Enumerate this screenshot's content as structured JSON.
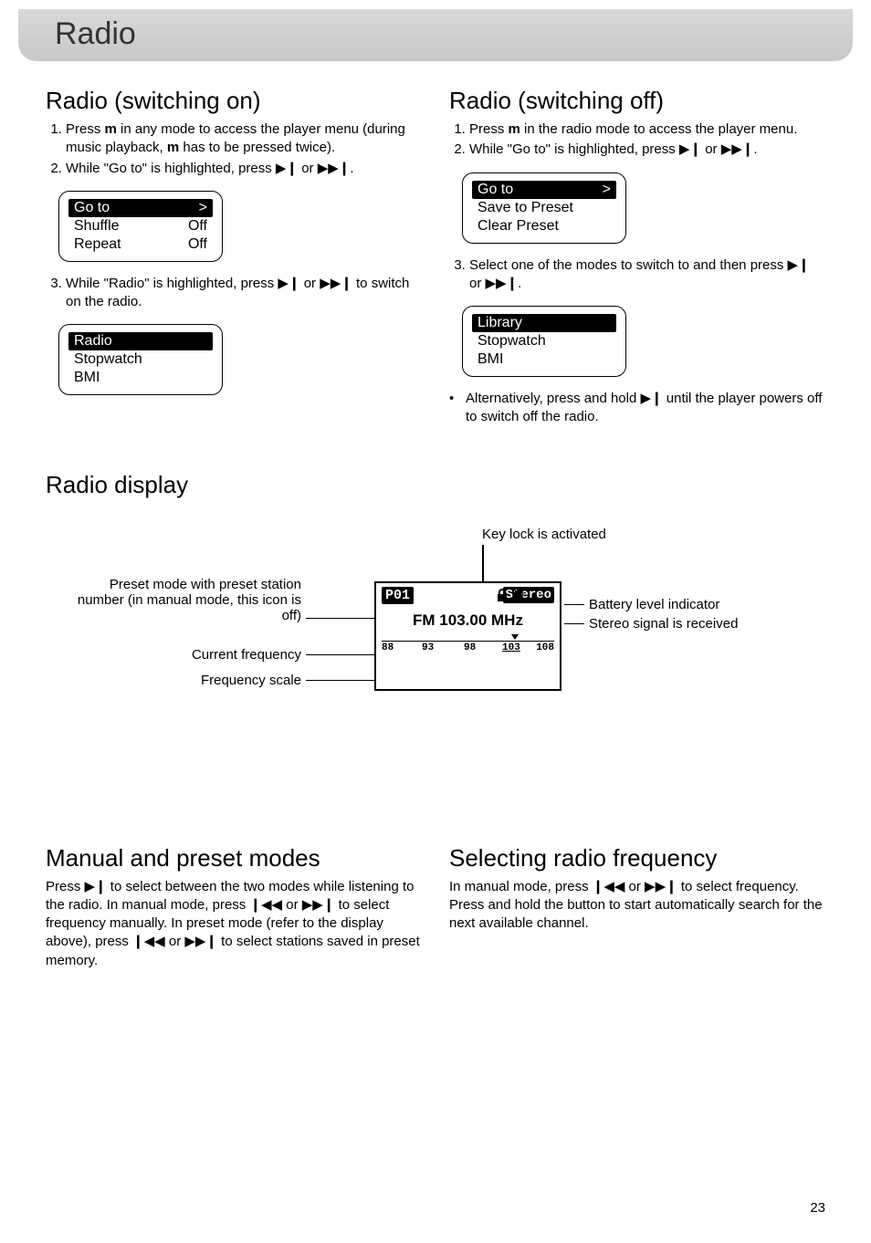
{
  "header": {
    "title": "Radio"
  },
  "left": {
    "switch_on_title": "Radio (switching on)",
    "steps_on": {
      "0_a": "Press ",
      "0_m": "m",
      "0_b": " in any mode to access the player menu (during music playback, ",
      "0_m2": "m",
      "0_c": " has to be pressed twice).",
      "1": "While \"Go to\" is highlighted, press ▶❙ or ▶▶❙.",
      "2": "While \"Radio\" is highlighted, press ▶❙ or ▶▶❙ to switch on the radio."
    },
    "menu1": {
      "r0": {
        "label": "Go to",
        "val": ">"
      },
      "r1": {
        "label": "Shuffle",
        "val": "Off"
      },
      "r2": {
        "label": "Repeat",
        "val": "Off"
      }
    },
    "menu2": {
      "r0": {
        "label": "Radio"
      },
      "r1": {
        "label": "Stopwatch"
      },
      "r2": {
        "label": "BMI"
      }
    }
  },
  "right": {
    "switch_off_title": "Radio (switching off)",
    "steps_off": {
      "0_a": "Press ",
      "0_m": "m",
      "0_b": " in the radio mode to access the player menu.",
      "1": "While \"Go to\" is highlighted, press ▶❙ or ▶▶❙.",
      "2": "Select one of the modes to switch to and then press ▶❙ or ▶▶❙."
    },
    "menu3": {
      "r0": {
        "label": "Go to",
        "val": ">"
      },
      "r1": {
        "label": "Save to Preset"
      },
      "r2": {
        "label": "Clear Preset"
      }
    },
    "menu4": {
      "r0": {
        "label": "Library"
      },
      "r1": {
        "label": "Stopwatch"
      },
      "r2": {
        "label": "BMI"
      }
    },
    "alt": "Alternatively, press and hold ▶❙ until the player powers off to switch off the radio."
  },
  "display": {
    "title": "Radio display",
    "anno": {
      "keylock": "Key lock is activated",
      "preset": "Preset mode with preset station number (in manual mode, this icon is off)",
      "current": "Current frequency",
      "scale": "Frequency scale",
      "battery": "Battery level indicator",
      "stereo": "Stereo signal is received"
    },
    "lcd": {
      "p01": "P01",
      "stereo": "Stereo",
      "freq": "FM 103.00 MHz",
      "ticks": [
        "88",
        "93",
        "98",
        "103",
        "108"
      ]
    }
  },
  "manual": {
    "title": "Manual and preset modes",
    "body": "Press ▶❙ to select between the two modes while listening to the radio. In manual mode, press ❙◀◀ or ▶▶❙ to select frequency manually. In preset mode (refer to the display above), press ❙◀◀ or ▶▶❙ to select stations saved in preset memory."
  },
  "selecting": {
    "title": "Selecting radio frequency",
    "body": "In manual mode, press ❙◀◀ or ▶▶❙ to select frequency. Press and hold the button to start automatically search for the next available channel."
  },
  "page": "23"
}
